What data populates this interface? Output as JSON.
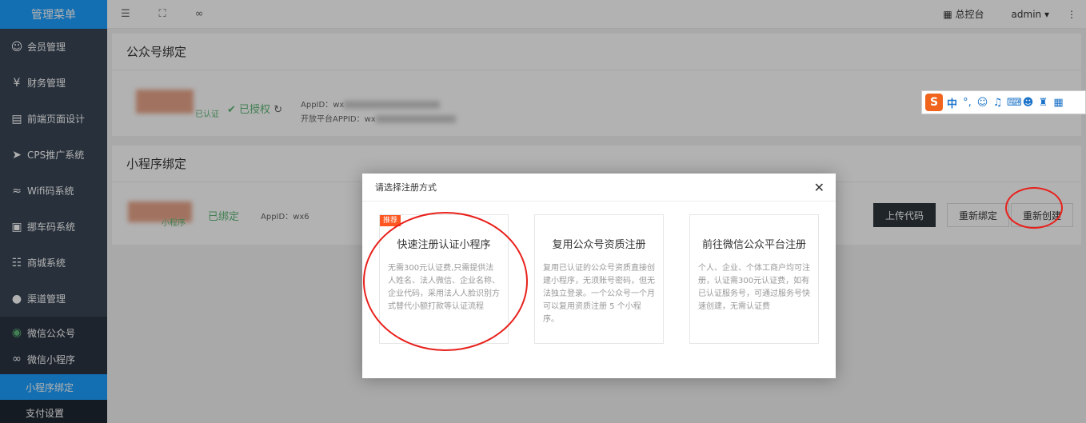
{
  "sidebar": {
    "brand": "管理菜单",
    "items": [
      {
        "label": "会员管理",
        "icon": "user-icon"
      },
      {
        "label": "财务管理",
        "icon": "yen-icon"
      },
      {
        "label": "前端页面设计",
        "icon": "layout-icon"
      },
      {
        "label": "CPS推广系统",
        "icon": "send-icon"
      },
      {
        "label": "Wifi码系统",
        "icon": "wifi-icon"
      },
      {
        "label": "挪车码系统",
        "icon": "car-icon"
      },
      {
        "label": "商城系统",
        "icon": "cart-icon"
      },
      {
        "label": "渠道管理",
        "icon": "circle-icon"
      },
      {
        "label": "微信公众号",
        "icon": "wechat-icon"
      },
      {
        "label": "微信小程序",
        "icon": "miniprogram-icon"
      }
    ],
    "subitems": [
      {
        "label": "小程序绑定"
      },
      {
        "label": "支付设置"
      }
    ]
  },
  "header": {
    "dashboard": "总控台",
    "user": "admin"
  },
  "official_account": {
    "title": "公众号绑定",
    "verified_tag": "已认证",
    "status": "已授权",
    "appid_label": "AppID：",
    "appid_value": "wx",
    "platform_appid_label": "开放平台APPID：",
    "platform_appid_value": "wx"
  },
  "mini_program": {
    "title": "小程序绑定",
    "name_tag": "小程序",
    "status": "已绑定",
    "appid_label": "AppID：",
    "appid_value": "wx6",
    "buttons": {
      "upload": "上传代码",
      "rebind": "重新绑定",
      "recreate": "重新创建"
    }
  },
  "modal": {
    "title": "请选择注册方式",
    "options": [
      {
        "tag": "推荐",
        "title": "快速注册认证小程序",
        "desc": "无需300元认证费,只需提供法人姓名、法人微信、企业名称、企业代码，采用法人人脸识别方式替代小额打款等认证流程"
      },
      {
        "title": "复用公众号资质注册",
        "desc": "复用已认证的公众号资质直接创建小程序，无须账号密码，但无法独立登录。一个公众号一个月可以复用资质注册 5 个小程序。"
      },
      {
        "title": "前往微信公众平台注册",
        "desc": "个人、企业、个体工商户均可注册，认证需300元认证费，如有已认证服务号，可通过服务号快速创建，无需认证费"
      }
    ]
  },
  "ime": {
    "lang": "中"
  },
  "colors": {
    "accent": "#1e9fff",
    "sidebar": "#394555",
    "success": "#5fb878",
    "tag": "#ff5722",
    "annotation": "#e8211c"
  }
}
